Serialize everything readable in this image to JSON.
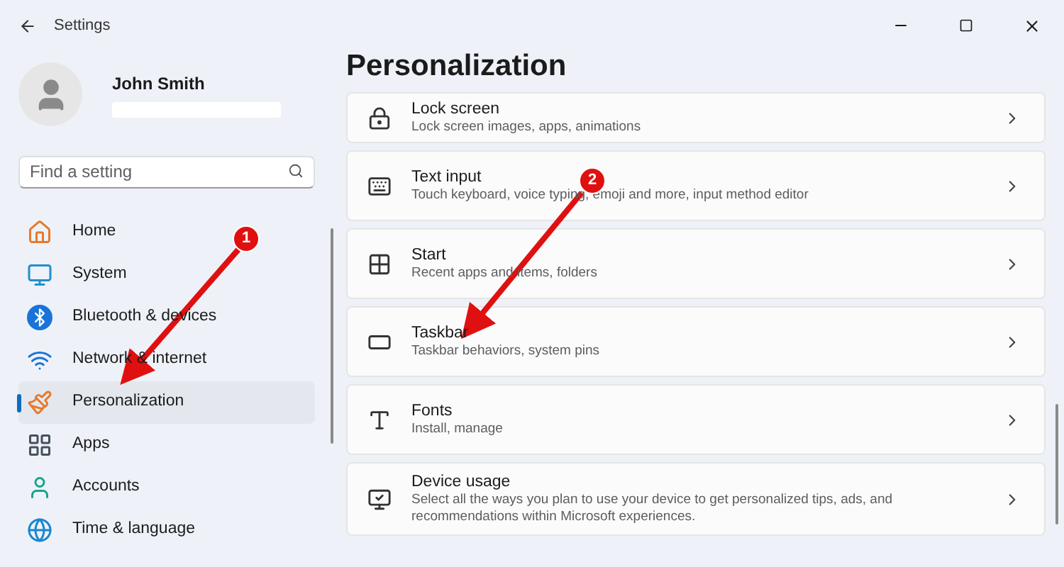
{
  "window": {
    "title": "Settings"
  },
  "profile": {
    "name": "John Smith"
  },
  "search": {
    "placeholder": "Find a setting"
  },
  "sidebar": {
    "items": [
      {
        "label": "Home",
        "selected": false
      },
      {
        "label": "System",
        "selected": false
      },
      {
        "label": "Bluetooth & devices",
        "selected": false
      },
      {
        "label": "Network & internet",
        "selected": false
      },
      {
        "label": "Personalization",
        "selected": true
      },
      {
        "label": "Apps",
        "selected": false
      },
      {
        "label": "Accounts",
        "selected": false
      },
      {
        "label": "Time & language",
        "selected": false
      }
    ]
  },
  "page": {
    "title": "Personalization",
    "items": [
      {
        "title": "Lock screen",
        "description": "Lock screen images, apps, animations"
      },
      {
        "title": "Text input",
        "description": "Touch keyboard, voice typing, emoji and more, input method editor"
      },
      {
        "title": "Start",
        "description": "Recent apps and items, folders"
      },
      {
        "title": "Taskbar",
        "description": "Taskbar behaviors, system pins"
      },
      {
        "title": "Fonts",
        "description": "Install, manage"
      },
      {
        "title": "Device usage",
        "description": "Select all the ways you plan to use your device to get personalized tips, ads, and recommendations within Microsoft experiences."
      }
    ]
  },
  "annotations": [
    {
      "label": "1"
    },
    {
      "label": "2"
    }
  ]
}
